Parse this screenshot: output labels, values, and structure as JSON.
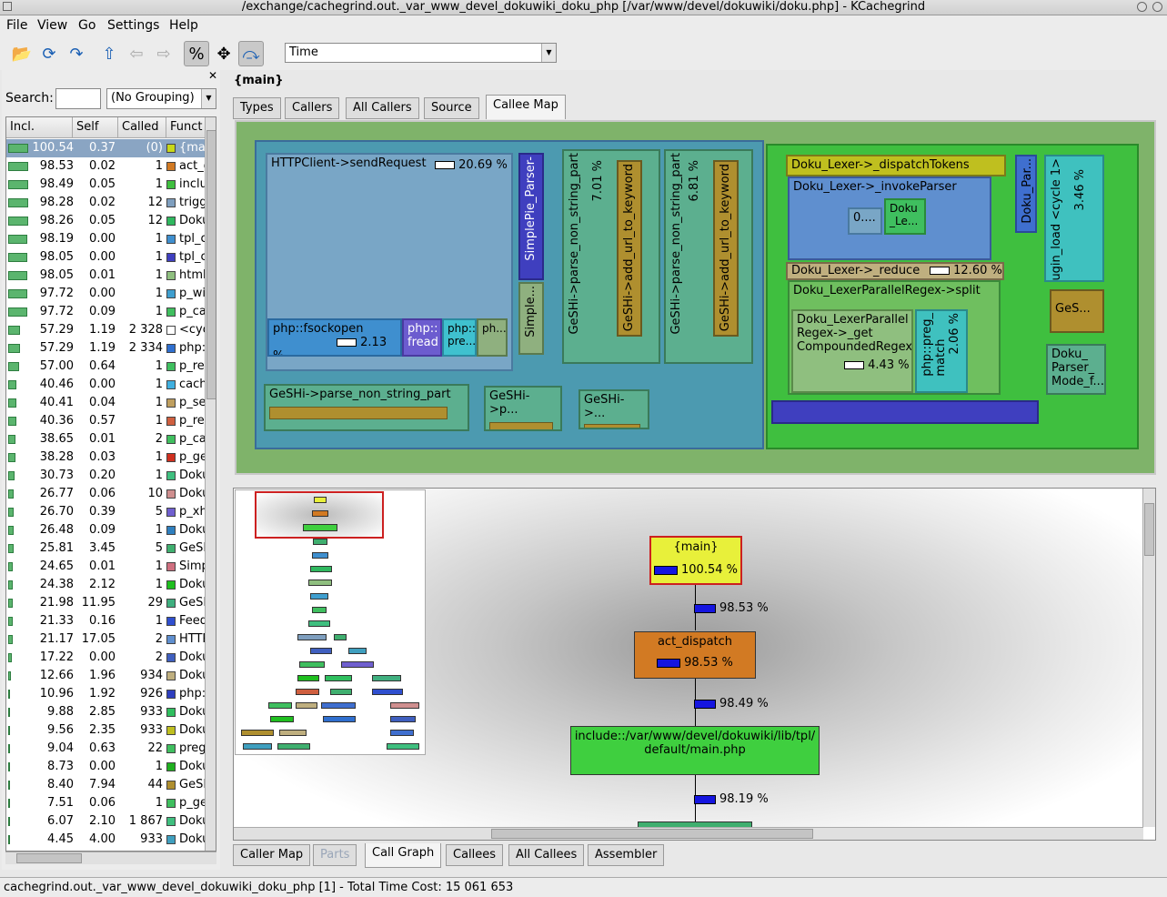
{
  "window": {
    "title": "/exchange/cachegrind.out._var_www_devel_dokuwiki_doku_php [/var/www/devel/dokuwiki/doku.php] - KCachegrind"
  },
  "menu": [
    "File",
    "View",
    "Go",
    "Settings",
    "Help"
  ],
  "toolbar": {
    "event_type": "Time",
    "percent_label": "%"
  },
  "search": {
    "label": "Search:",
    "value": "",
    "grouping": "(No Grouping)"
  },
  "function_list": {
    "headers": [
      "Incl.",
      "Self",
      "Called",
      "Funct"
    ],
    "rows": [
      {
        "incl": "100.54",
        "self": "0.37",
        "called": "(0)",
        "func": "{main}",
        "color": "#c8d818"
      },
      {
        "incl": "98.53",
        "self": "0.02",
        "called": "1",
        "func": "act_dispatch",
        "color": "#d27a23"
      },
      {
        "incl": "98.49",
        "self": "0.05",
        "called": "1",
        "func": "include::",
        "color": "#3fbf3f"
      },
      {
        "incl": "98.28",
        "self": "0.02",
        "called": "12",
        "func": "trigger",
        "color": "#7f9fbf"
      },
      {
        "incl": "98.26",
        "self": "0.05",
        "called": "12",
        "func": "Doku",
        "color": "#2fb85f"
      },
      {
        "incl": "98.19",
        "self": "0.00",
        "called": "1",
        "func": "tpl_content",
        "color": "#3f8fcf"
      },
      {
        "incl": "98.05",
        "self": "0.00",
        "called": "1",
        "func": "tpl_content_core",
        "color": "#3f3fbf"
      },
      {
        "incl": "98.05",
        "self": "0.01",
        "called": "1",
        "func": "html",
        "color": "#8fbf7f"
      },
      {
        "incl": "97.72",
        "self": "0.00",
        "called": "1",
        "func": "p_wiki",
        "color": "#3f9fcf"
      },
      {
        "incl": "97.72",
        "self": "0.09",
        "called": "1",
        "func": "p_cached",
        "color": "#3fbf5f"
      },
      {
        "incl": "57.29",
        "self": "1.19",
        "called": "2 328",
        "func": "<cycle",
        "color": "#ffffff"
      },
      {
        "incl": "57.29",
        "self": "1.19",
        "called": "2 334",
        "func": "php::",
        "color": "#2f6fcf"
      },
      {
        "incl": "57.00",
        "self": "0.64",
        "called": "1",
        "func": "p_render",
        "color": "#3fbf5f"
      },
      {
        "incl": "40.46",
        "self": "0.00",
        "called": "1",
        "func": "cache",
        "color": "#3fafdf"
      },
      {
        "incl": "40.41",
        "self": "0.04",
        "called": "1",
        "func": "p_set",
        "color": "#bf9f5f"
      },
      {
        "incl": "40.36",
        "self": "0.57",
        "called": "1",
        "func": "p_render",
        "color": "#cf5f3f"
      },
      {
        "incl": "38.65",
        "self": "0.01",
        "called": "2",
        "func": "p_cached",
        "color": "#3fbf5f"
      },
      {
        "incl": "38.28",
        "self": "0.03",
        "called": "1",
        "func": "p_get",
        "color": "#cf2f1f"
      },
      {
        "incl": "30.73",
        "self": "0.20",
        "called": "1",
        "func": "Doku",
        "color": "#3fbf7f"
      },
      {
        "incl": "26.77",
        "self": "0.06",
        "called": "10",
        "func": "Doku",
        "color": "#cf8f8f"
      },
      {
        "incl": "26.70",
        "self": "0.39",
        "called": "5",
        "func": "p_xhtml",
        "color": "#6f5fcf"
      },
      {
        "incl": "26.48",
        "self": "0.09",
        "called": "1",
        "func": "Doku",
        "color": "#2f7fbf"
      },
      {
        "incl": "25.81",
        "self": "3.45",
        "called": "5",
        "func": "GeSHi",
        "color": "#3faf6f"
      },
      {
        "incl": "24.65",
        "self": "0.01",
        "called": "1",
        "func": "Simple",
        "color": "#cf6f7f"
      },
      {
        "incl": "24.38",
        "self": "2.12",
        "called": "1",
        "func": "Doku",
        "color": "#1fbf1f"
      },
      {
        "incl": "21.98",
        "self": "11.95",
        "called": "29",
        "func": "GeSHi",
        "color": "#3faf7f"
      },
      {
        "incl": "21.33",
        "self": "0.16",
        "called": "1",
        "func": "Feed",
        "color": "#2f4fcf"
      },
      {
        "incl": "21.17",
        "self": "17.05",
        "called": "2",
        "func": "HTTP",
        "color": "#5f8fcf"
      },
      {
        "incl": "17.22",
        "self": "0.00",
        "called": "2",
        "func": "Doku",
        "color": "#3f5fbf"
      },
      {
        "incl": "12.66",
        "self": "1.96",
        "called": "934",
        "func": "Doku",
        "color": "#bfaf7f"
      },
      {
        "incl": "10.96",
        "self": "1.92",
        "called": "926",
        "func": "php::",
        "color": "#2f3fbf"
      },
      {
        "incl": "9.88",
        "self": "2.85",
        "called": "933",
        "func": "Doku",
        "color": "#2fbf5f"
      },
      {
        "incl": "9.56",
        "self": "2.35",
        "called": "933",
        "func": "Doku",
        "color": "#bfbf1f"
      },
      {
        "incl": "9.04",
        "self": "0.63",
        "called": "22",
        "func": "preg",
        "color": "#3fbf5f"
      },
      {
        "incl": "8.73",
        "self": "0.00",
        "called": "1",
        "func": "Doku",
        "color": "#1faf1f"
      },
      {
        "incl": "8.40",
        "self": "7.94",
        "called": "44",
        "func": "GeSHi",
        "color": "#af8f2f"
      },
      {
        "incl": "7.51",
        "self": "0.06",
        "called": "1",
        "func": "p_get",
        "color": "#3fbf5f"
      },
      {
        "incl": "6.07",
        "self": "2.10",
        "called": "1 867",
        "func": "Doku",
        "color": "#3fbf7f"
      },
      {
        "incl": "4.45",
        "self": "4.00",
        "called": "933",
        "func": "Doku",
        "color": "#3f9fbf"
      }
    ]
  },
  "header": {
    "function_name": "{main}"
  },
  "top_tabs": [
    "Types",
    "Callers",
    "All Callers",
    "Source",
    "Callee Map"
  ],
  "treemap": {
    "http_send": "HTTPClient->sendRequest",
    "http_pct": "20.69 %",
    "simplepie": "SimplePie_Parser-",
    "simple2": "Simple...",
    "fsockopen": "php::fsockopen",
    "fsockopen_pct": "2.13 %",
    "fread": "php::\nfread",
    "pre": "php::\npre...",
    "ph": "ph...",
    "geshi_pnsp1": "GeSHi->parse_non_string_part",
    "geshi_pnsp1_pct": "7.01 %",
    "geshi_url1": "GeSHi->add_url_to_keyword",
    "geshi_pnsp2": "GeSHi->parse_non_string_part",
    "geshi_pnsp2_pct": "6.81 %",
    "geshi_url2": "GeSHi->add_url_to_keyword",
    "geshi_pnsp3": "GeSHi->parse_non_string_part",
    "geshi_p": "GeSHi->p...",
    "geshi_3": "GeSHi->...",
    "dispatch": "Doku_Lexer->_dispatchTokens",
    "invoke": "Doku_Lexer->_invokeParser",
    "zero": "0....",
    "doku_le": "Doku\n_Le...",
    "doku_par": "Doku_Par...",
    "plugin": "plugin_load <cycle 1>",
    "plugin_pct": "3.46 %",
    "reduce": "Doku_Lexer->_reduce",
    "reduce_pct": "12.60 %",
    "split": "Doku_LexerParallelRegex->split",
    "compound": "Doku_LexerParallel\nRegex->_get\nCompoundedRegex",
    "compound_pct": "4.43 %",
    "pregmatch": "php::preg_\nmatch",
    "pregmatch_pct": "2.06 %",
    "ges": "GeS...",
    "parser_mode": "Doku_\nParser_\nMode_f..."
  },
  "callgraph": {
    "main_node": "{main}",
    "main_pct": "100.54 %",
    "e1": "98.53 %",
    "act_node": "act_dispatch",
    "act_pct": "98.53 %",
    "e2": "98.49 %",
    "include_node": "include::/var/www/devel/dokuwiki/lib/tpl/\ndefault/main.php",
    "e3": "98.19 %"
  },
  "bottom_tabs": [
    "Caller Map",
    "Parts",
    "Call Graph",
    "Callees",
    "All Callees",
    "Assembler"
  ],
  "status": "cachegrind.out._var_www_devel_dokuwiki_doku_php [1] - Total Time Cost:  15 061 653"
}
